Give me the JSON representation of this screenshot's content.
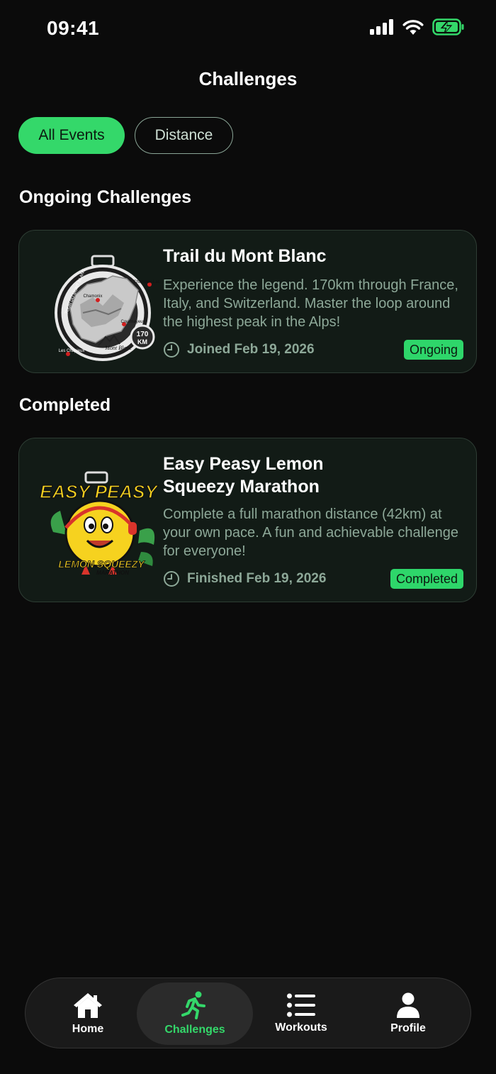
{
  "status": {
    "time": "09:41"
  },
  "header": {
    "title": "Challenges"
  },
  "filters": [
    {
      "label": "All Events",
      "active": true
    },
    {
      "label": "Distance",
      "active": false
    }
  ],
  "sections": {
    "ongoing": {
      "title": "Ongoing Challenges",
      "card": {
        "title": "Trail du Mont Blanc",
        "description": "Experience the legend. 170km through France, Italy, and Switzerland. Master the loop around the highest peak in the Alps!",
        "meta": "Joined Feb 19, 2026",
        "badge": "Ongoing",
        "image": {
          "ring_text": "TOUR DU MONT BLANC",
          "places": [
            "Champex-Lac",
            "Chamonix",
            "Courmayeur",
            "Les Chapieux"
          ],
          "brand": "Mont Blanc",
          "distance": "170",
          "unit": "KM"
        }
      }
    },
    "completed": {
      "title": "Completed",
      "card": {
        "title_line1": "Easy Peasy Lemon",
        "title_line2": "Squeezy Marathon",
        "description": "Complete a full marathon distance (42km) at your own pace. A fun and achievable challenge for everyone!",
        "meta": "Finished Feb 19, 2026",
        "badge": "Completed",
        "image": {
          "top_text": "EASY PEASY",
          "bottom_text": "LEMON SQUEEZY",
          "sub_text": "MARATHON"
        }
      }
    }
  },
  "tabbar": [
    {
      "label": "Home",
      "icon": "home-icon",
      "active": false
    },
    {
      "label": "Challenges",
      "icon": "running-icon",
      "active": true
    },
    {
      "label": "Workouts",
      "icon": "list-icon",
      "active": false
    },
    {
      "label": "Profile",
      "icon": "person-icon",
      "active": false
    }
  ],
  "colors": {
    "accent": "#34d86a",
    "background": "#0b0b0b",
    "card": "#121b16",
    "muted_text": "#8da898"
  }
}
